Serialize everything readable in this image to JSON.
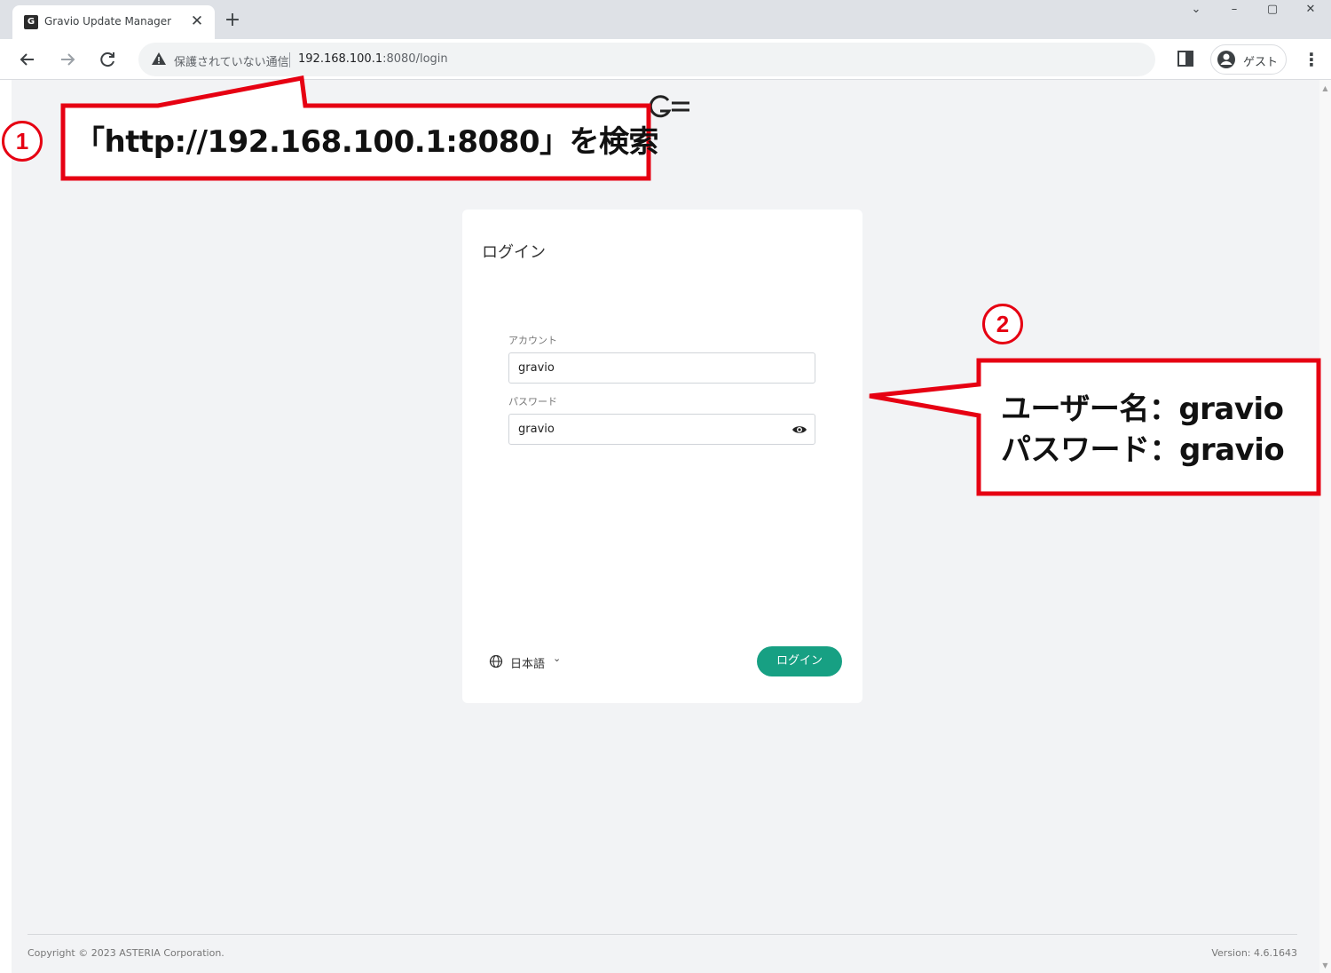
{
  "browser": {
    "tab_title": "Gravio Update Manager",
    "tab_close": "✕",
    "new_tab": "+",
    "window_controls": {
      "chevron": "⌄",
      "minimize": "–",
      "maximize": "▢",
      "close": "✕"
    },
    "not_secure_label": "保護されていない通信",
    "url_host": "192.168.100.1",
    "url_path": ":8080/login",
    "profile_label": "ゲスト"
  },
  "login_card": {
    "title": "ログイン",
    "account_label": "アカウント",
    "account_value": "gravio",
    "password_label": "パスワード",
    "password_value": "gravio",
    "language": "日本語",
    "login_button": "ログイン"
  },
  "footer": {
    "copyright": "Copyright © 2023 ASTERIA Corporation.",
    "version": "Version: 4.6.1643"
  },
  "annotations": {
    "step1_number": "1",
    "step1_text": "「http://192.168.100.1:8080」を検索",
    "step2_number": "2",
    "step2_line1": "ユーザー名：gravio",
    "step2_line2": "パスワード：gravio",
    "accent_color": "#e60012"
  },
  "colors": {
    "login_button": "#17a083",
    "page_background": "#f2f3f5"
  }
}
